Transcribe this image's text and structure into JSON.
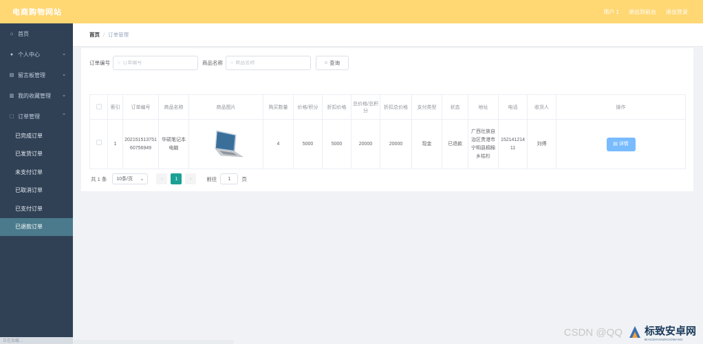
{
  "topbar": {
    "brand": "电商购物网站",
    "nav": [
      "用户 1",
      "退出到前台",
      "退出登录"
    ]
  },
  "sidebar": {
    "menu": [
      {
        "label": "首页",
        "icon": "home-icon",
        "has_children": false
      },
      {
        "label": "个人中心",
        "icon": "user-icon",
        "has_children": true
      },
      {
        "label": "留言板管理",
        "icon": "message-icon",
        "has_children": true
      },
      {
        "label": "我的收藏管理",
        "icon": "collection-icon",
        "has_children": true
      },
      {
        "label": "订单管理",
        "icon": "order-icon",
        "has_children": true,
        "expanded": true
      }
    ],
    "submenu": [
      "已完成订单",
      "已发货订单",
      "未支付订单",
      "已取消订单",
      "已支付订单",
      "已退款订单"
    ],
    "active_submenu": "已退款订单",
    "footer_text": "正在加载..."
  },
  "breadcrumb": {
    "home": "首页",
    "separator": "/",
    "current": "订单管理"
  },
  "search": {
    "order_no_label": "订单编号",
    "order_no_placeholder": "订单编号",
    "product_name_label": "商品名称",
    "product_name_placeholder": "商品名称",
    "query_button": "查询"
  },
  "table": {
    "headers": [
      "",
      "索引",
      "订单编号",
      "商品名称",
      "商品图片",
      "购买数量",
      "价格/积分",
      "折扣价格",
      "总价格/总积分",
      "折扣总价格",
      "支付类型",
      "状态",
      "地址",
      "电话",
      "收货人",
      "操作"
    ],
    "rows": [
      {
        "index": "1",
        "order_no": "20215151375160756949",
        "product_name": "华硕笔记本电脑",
        "quantity": "4",
        "price": "5000",
        "discount_price": "5000",
        "total_price": "20000",
        "discount_total": "20000",
        "pay_type": "现金",
        "status": "已退款",
        "address": "广西壮族自治区贵港市宁明县桐棉乡枯杉",
        "phone": "15214121411",
        "receiver": "刘傅",
        "action": "详情"
      }
    ]
  },
  "pagination": {
    "total": "共 1 条",
    "page_size": "10条/页",
    "current_page": "1",
    "goto_label": "前往",
    "goto_value": "1",
    "page_suffix": "页"
  },
  "watermark": {
    "csdn": "CSDN @QQ",
    "site_name": "标致安卓网",
    "site_sub": "BIAOZHIANZHUOWANG"
  },
  "colors": {
    "topbar": "#ffd773",
    "sidebar": "#304156",
    "active_item": "#4a7a8c",
    "detail_button": "#79bbff",
    "current_page": "#1aa094"
  }
}
